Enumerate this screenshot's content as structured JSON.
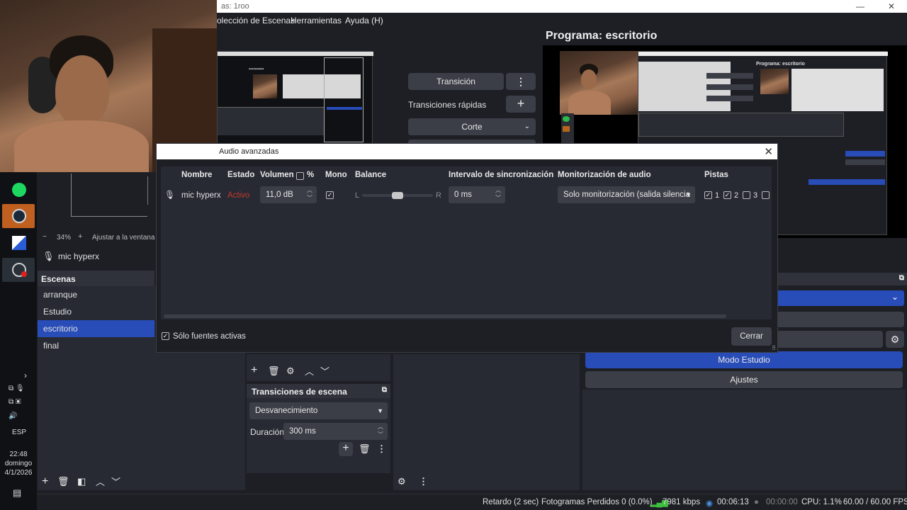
{
  "window": {
    "title": "as: 1roo"
  },
  "menu": {
    "scene_collection": "olección de Escenas",
    "tools": "Herramientas",
    "help": "Ayuda (H)"
  },
  "program": {
    "label": "Programa: escritorio"
  },
  "transition_controls": {
    "transition_button": "Transición",
    "quick_transitions": "Transiciones rápidas",
    "cut": "Corte"
  },
  "preview_zoom": {
    "percent": "34%",
    "fit": "Ajustar a la ventana"
  },
  "audio_source": {
    "name": "mic hyperx"
  },
  "scenes": {
    "title": "Escenas",
    "items": [
      "arranque",
      "Estudio",
      "escritorio",
      "final"
    ],
    "selected_index": 2
  },
  "scene_transitions": {
    "title": "Transiciones de escena",
    "selected": "Desvanecimiento",
    "duration_label": "Duración",
    "duration_value": "300 ms"
  },
  "controls": {
    "studio_mode": "Modo Estudio",
    "settings": "Ajustes"
  },
  "dialog": {
    "title": "Audio avanzadas",
    "headers": {
      "name": "Nombre",
      "status": "Estado",
      "volume": "Volumen",
      "percent": "%",
      "mono": "Mono",
      "balance": "Balance",
      "sync": "Intervalo de sincronización",
      "monitoring": "Monitorización de audio",
      "tracks": "Pistas"
    },
    "row": {
      "name": "mic hyperx",
      "status": "Activo",
      "volume": "11,0 dB",
      "mono": true,
      "balance_left": "L",
      "balance_right": "R",
      "balance_value": 0.5,
      "sync": "0 ms",
      "monitoring": "Solo monitorización (salida silencia",
      "tracks": [
        {
          "label": "1",
          "checked": true
        },
        {
          "label": "2",
          "checked": true
        },
        {
          "label": "3",
          "checked": false
        },
        {
          "label": "",
          "checked": false
        }
      ]
    },
    "active_only_label": "Sólo fuentes activas",
    "close_button": "Cerrar"
  },
  "taskbar": {
    "lang": "ESP",
    "time": "22:48",
    "day": "domingo",
    "date": "4/1/2026"
  },
  "status": {
    "delay": "Retardo (2 sec)",
    "dropped": "Fotogramas Perdidos 0 (0.0%)",
    "bitrate": "7981 kbps",
    "live_time": "00:06:13",
    "rec_time": "00:00:00",
    "cpu": "CPU: 1.1%",
    "fps": "60.00 / 60.00 FPS"
  },
  "colors": {
    "accent": "#284cb8",
    "status_active": "#c0392b",
    "bitrate": "#3fbf3f"
  }
}
